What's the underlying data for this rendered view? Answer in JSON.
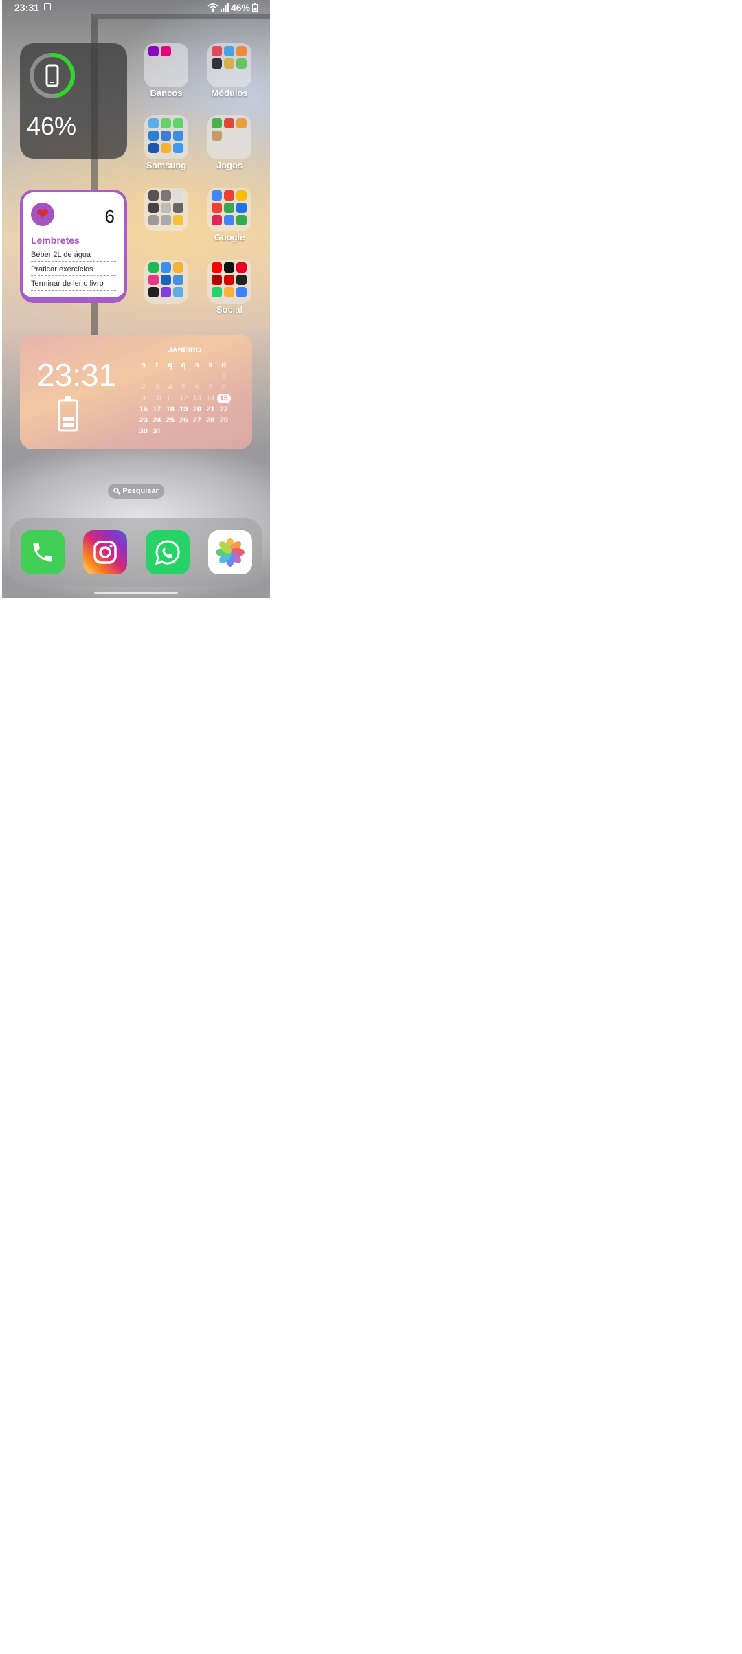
{
  "status_bar": {
    "time": "23:31",
    "battery": "46%"
  },
  "battery_widget": {
    "percent": "46%",
    "level": 0.46,
    "ring_color": "#2fd42f"
  },
  "folders": [
    {
      "label": "Bancos",
      "icons": [
        "nubank-icon",
        "c6-icon"
      ],
      "colors": [
        "#8a05be",
        "#e5007d"
      ]
    },
    {
      "label": "Módulos",
      "icons": [
        "app-icon",
        "app-icon",
        "app-icon",
        "app-icon",
        "app-icon",
        "app-icon"
      ],
      "colors": [
        "#e24a5a",
        "#4aa3e0",
        "#f08a3c",
        "#333333",
        "#d6b04a",
        "#65c466"
      ]
    },
    {
      "label": "Samsung",
      "icons": [
        "app-icon",
        "app-icon",
        "app-icon",
        "app-icon",
        "app-icon",
        "app-icon",
        "app-icon",
        "app-icon",
        "app-icon"
      ],
      "colors": [
        "#5ab0e6",
        "#6ad06a",
        "#5fd46c",
        "#2a7fd0",
        "#3b7fd6",
        "#3d8fe0",
        "#1e56b0",
        "#f5b236",
        "#3f97f0"
      ]
    },
    {
      "label": "Jogos",
      "icons": [
        "app-icon",
        "app-icon",
        "app-icon",
        "app-icon"
      ],
      "colors": [
        "#4ab04a",
        "#e04a3a",
        "#e8a03a",
        "#c89a6a"
      ]
    },
    {
      "label": "",
      "icons": [
        "app-icon",
        "app-icon",
        "app-icon",
        "app-icon",
        "app-icon",
        "app-icon",
        "app-icon",
        "app-icon",
        "app-icon"
      ],
      "colors": [
        "#555555",
        "#777777",
        "#dddddd",
        "#444444",
        "#bbbbbb",
        "#666666",
        "#999999",
        "#aaaaaa",
        "#f2c23a"
      ]
    },
    {
      "label": "Google",
      "icons": [
        "app-icon",
        "app-icon",
        "app-icon",
        "app-icon",
        "app-icon",
        "app-icon",
        "app-icon",
        "app-icon",
        "app-icon"
      ],
      "colors": [
        "#4285f4",
        "#ea4335",
        "#fbbc05",
        "#ea4335",
        "#34a853",
        "#1a73e8",
        "#e0245e",
        "#4285f4",
        "#34a853"
      ]
    },
    {
      "label": "",
      "icons": [
        "app-icon",
        "app-icon",
        "app-icon",
        "app-icon",
        "app-icon",
        "app-icon",
        "app-icon",
        "app-icon",
        "app-icon"
      ],
      "colors": [
        "#1db954",
        "#3b8fe8",
        "#f5b236",
        "#e23a8a",
        "#1565c0",
        "#4a90e2",
        "#222222",
        "#7b3fe4",
        "#5ab0e6"
      ]
    },
    {
      "label": "Social",
      "icons": [
        "app-icon",
        "app-icon",
        "app-icon",
        "app-icon",
        "app-icon",
        "app-icon",
        "app-icon",
        "app-icon",
        "app-icon"
      ],
      "colors": [
        "#ff0000",
        "#111111",
        "#e60023",
        "#b00000",
        "#d40000",
        "#222222",
        "#25d366",
        "#f5b236",
        "#3b82f6"
      ]
    }
  ],
  "reminders_widget": {
    "count": "6",
    "title": "Lembretes",
    "items": [
      "Beber 2L de água",
      "Praticar exercícios",
      "Terminar de ler o livro"
    ]
  },
  "clock_widget": {
    "time": "23:31",
    "month": "JANEIRO",
    "weekdays": [
      "s",
      "t",
      "q",
      "q",
      "s",
      "s",
      "d"
    ],
    "days": [
      "",
      "",
      "",
      "",
      "",
      "",
      "1",
      "2",
      "3",
      "4",
      "5",
      "6",
      "7",
      "8",
      "9",
      "10",
      "11",
      "12",
      "13",
      "14",
      "15",
      "16",
      "17",
      "18",
      "19",
      "20",
      "21",
      "22",
      "23",
      "24",
      "25",
      "26",
      "27",
      "28",
      "29",
      "30",
      "31"
    ],
    "today": "15"
  },
  "search": {
    "label": "Pesquisar"
  },
  "dock": [
    {
      "name": "phone-app-icon",
      "bg": "#3fcf57"
    },
    {
      "name": "instagram-app-icon",
      "bg": "#d62976"
    },
    {
      "name": "whatsapp-app-icon",
      "bg": "#25d366"
    },
    {
      "name": "photos-app-icon",
      "bg": "#ffffff"
    }
  ]
}
